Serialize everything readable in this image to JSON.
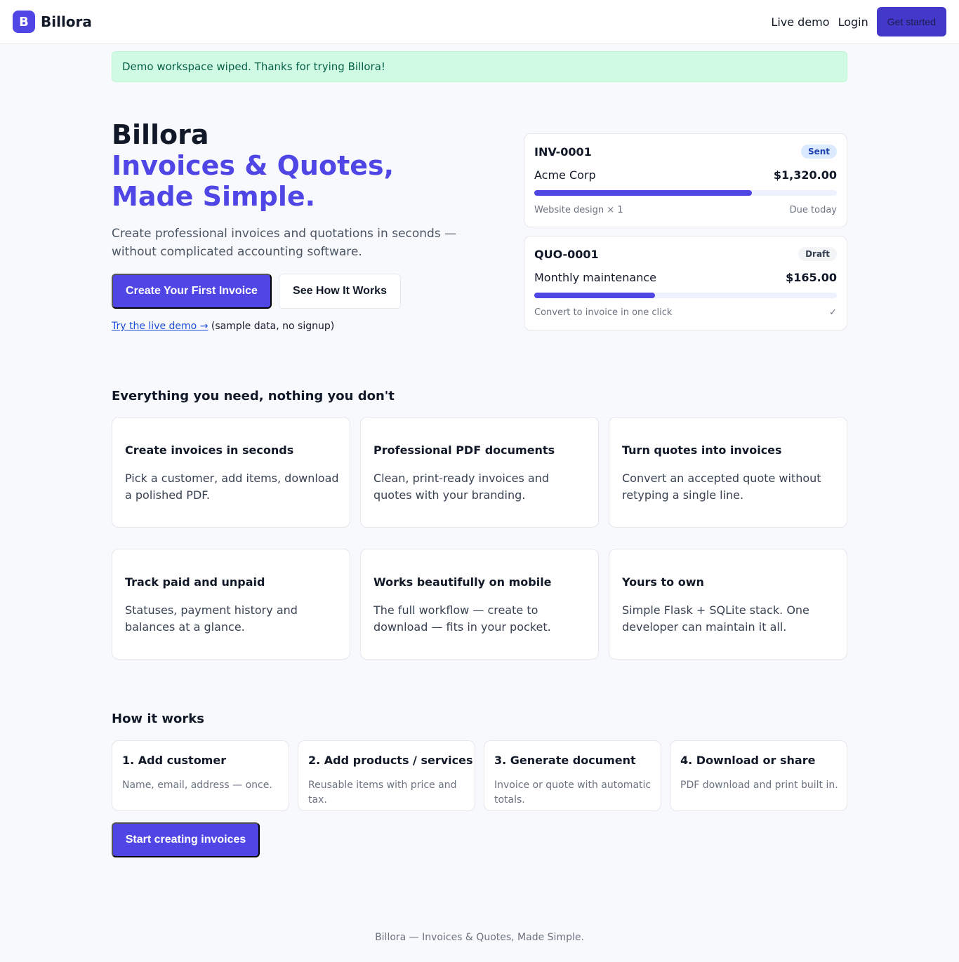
{
  "nav": {
    "logo_letter": "B",
    "brand": "Billora",
    "live_demo": "Live demo",
    "login": "Login",
    "get_started": "Get started"
  },
  "alert": {
    "message": "Demo workspace wiped. Thanks for trying Billora!"
  },
  "hero": {
    "title": "Billora",
    "tagline": "Invoices & Quotes, Made Simple.",
    "subtitle": "Create professional invoices and quotations in seconds — without complicated accounting software.",
    "primary_cta": "Create Your First Invoice",
    "secondary_cta": "See How It Works",
    "demo_link": "Try the live demo →",
    "demo_note": "(sample data, no signup)"
  },
  "documents": [
    {
      "id": "INV-0001",
      "status": "Sent",
      "client": "Acme Corp",
      "amount": "$1,320.00",
      "progress": 0.72,
      "detail": "Website design × 1",
      "meta": "Due today"
    },
    {
      "id": "QUO-0001",
      "status": "Draft",
      "client": "Monthly maintenance",
      "amount": "$165.00",
      "progress": 0.4,
      "detail": "Convert to invoice in one click",
      "meta": "✓"
    }
  ],
  "features": {
    "heading": "Everything you need, nothing you don't",
    "items": [
      {
        "title": "Create invoices in seconds",
        "desc": "Pick a customer, add items, download a polished PDF."
      },
      {
        "title": "Professional PDF documents",
        "desc": "Clean, print-ready invoices and quotes with your branding."
      },
      {
        "title": "Turn quotes into invoices",
        "desc": "Convert an accepted quote without retyping a single line."
      },
      {
        "title": "Track paid and unpaid",
        "desc": "Statuses, payment history and balances at a glance."
      },
      {
        "title": "Works beautifully on mobile",
        "desc": "The full workflow — create to download — fits in your pocket."
      },
      {
        "title": "Yours to own",
        "desc": "Simple Flask + SQLite stack. One developer can maintain it all."
      }
    ]
  },
  "how": {
    "heading": "How it works",
    "steps": [
      {
        "title": "1. Add customer",
        "desc": "Name, email, address — once."
      },
      {
        "title": "2. Add products / services",
        "desc": "Reusable items with price and tax."
      },
      {
        "title": "3. Generate document",
        "desc": "Invoice or quote with automatic totals."
      },
      {
        "title": "4. Download or share",
        "desc": "PDF download and print built in."
      }
    ],
    "cta": "Start creating invoices"
  },
  "footer": {
    "text": "Billora — Invoices & Quotes, Made Simple."
  },
  "colors": {
    "accent": "#4f46e5",
    "alert_bg": "#d1fae5",
    "alert_text": "#065f46"
  }
}
